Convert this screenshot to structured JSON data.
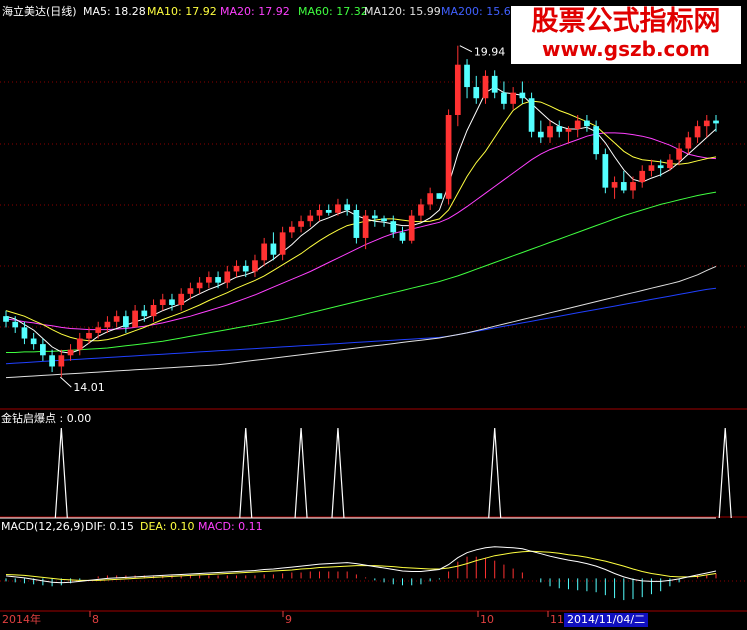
{
  "header": {
    "title": "海立美达(日线)",
    "ma_items": [
      {
        "label": "MA5: 18.28",
        "color": "#ffffff"
      },
      {
        "label": "MA10: 17.92",
        "color": "#ffff40"
      },
      {
        "label": "MA20: 17.92",
        "color": "#ff40ff"
      },
      {
        "label": "MA60: 17.32",
        "color": "#40ff40"
      },
      {
        "label": "MA120: 15.99",
        "color": "#e0e0e0"
      },
      {
        "label": "MA200: 15.60",
        "color": "#4060ff"
      }
    ]
  },
  "watermark": {
    "line1": "股票公式指标网",
    "line2": "www.gszb.com"
  },
  "indicator": {
    "label": "金钻启爆点 : 0.00"
  },
  "macd": {
    "name": "MACD(12,26,9)",
    "dif": "DIF: 0.15",
    "dea": "DEA: 0.10",
    "macd": "MACD: 0.11"
  },
  "x_axis": {
    "labels": [
      "2014年",
      "8",
      "9",
      "10",
      "11"
    ],
    "selected_date": "2014/11/04/二"
  },
  "colors": {
    "up": "#ff3232",
    "down": "#54ffff",
    "grid": "#8b0000",
    "ma5": "#ffffff",
    "ma10": "#ffff40",
    "ma20": "#ff40ff",
    "ma60": "#40ff40",
    "ma120": "#e0e0e0",
    "ma200": "#2040ff"
  },
  "chart_data": {
    "type": "candlestick",
    "annotations": [
      {
        "text": "19.94",
        "kind": "high"
      },
      {
        "text": "14.01",
        "kind": "low"
      }
    ],
    "price_ylim": [
      13.6,
      20.4
    ],
    "candles": [
      [
        15.1,
        15.2,
        14.9,
        15.0
      ],
      [
        15.0,
        15.1,
        14.8,
        14.9
      ],
      [
        14.9,
        15.0,
        14.6,
        14.7
      ],
      [
        14.7,
        14.8,
        14.5,
        14.6
      ],
      [
        14.6,
        14.7,
        14.3,
        14.4
      ],
      [
        14.4,
        14.5,
        14.1,
        14.2
      ],
      [
        14.2,
        14.5,
        14.01,
        14.4
      ],
      [
        14.4,
        14.6,
        14.3,
        14.5
      ],
      [
        14.5,
        14.8,
        14.4,
        14.7
      ],
      [
        14.7,
        14.9,
        14.6,
        14.8
      ],
      [
        14.8,
        15.0,
        14.7,
        14.9
      ],
      [
        14.9,
        15.1,
        14.8,
        15.0
      ],
      [
        15.0,
        15.2,
        14.9,
        15.1
      ],
      [
        15.1,
        15.2,
        14.8,
        14.9
      ],
      [
        14.9,
        15.3,
        14.9,
        15.2
      ],
      [
        15.2,
        15.3,
        15.0,
        15.1
      ],
      [
        15.1,
        15.4,
        15.0,
        15.3
      ],
      [
        15.3,
        15.5,
        15.2,
        15.4
      ],
      [
        15.4,
        15.5,
        15.2,
        15.3
      ],
      [
        15.3,
        15.6,
        15.2,
        15.5
      ],
      [
        15.5,
        15.7,
        15.4,
        15.6
      ],
      [
        15.6,
        15.8,
        15.5,
        15.7
      ],
      [
        15.7,
        15.9,
        15.6,
        15.8
      ],
      [
        15.8,
        15.9,
        15.6,
        15.7
      ],
      [
        15.7,
        16.0,
        15.6,
        15.9
      ],
      [
        15.9,
        16.1,
        15.8,
        16.0
      ],
      [
        16.0,
        16.1,
        15.8,
        15.9
      ],
      [
        15.9,
        16.2,
        15.8,
        16.1
      ],
      [
        16.1,
        16.5,
        16.0,
        16.4
      ],
      [
        16.4,
        16.6,
        16.1,
        16.2
      ],
      [
        16.2,
        16.7,
        16.1,
        16.6
      ],
      [
        16.6,
        16.8,
        16.5,
        16.7
      ],
      [
        16.7,
        16.9,
        16.6,
        16.8
      ],
      [
        16.8,
        17.0,
        16.7,
        16.9
      ],
      [
        16.9,
        17.1,
        16.8,
        17.0
      ],
      [
        17.0,
        17.1,
        16.9,
        16.95
      ],
      [
        16.95,
        17.2,
        16.9,
        17.1
      ],
      [
        17.1,
        17.2,
        16.9,
        17.0
      ],
      [
        17.0,
        17.1,
        16.4,
        16.5
      ],
      [
        16.5,
        17.0,
        16.3,
        16.9
      ],
      [
        16.9,
        17.0,
        16.7,
        16.85
      ],
      [
        16.85,
        16.9,
        16.7,
        16.8
      ],
      [
        16.8,
        16.9,
        16.5,
        16.6
      ],
      [
        16.6,
        16.7,
        16.4,
        16.45
      ],
      [
        16.45,
        17.0,
        16.4,
        16.9
      ],
      [
        16.9,
        17.2,
        16.8,
        17.1
      ],
      [
        17.1,
        17.4,
        17.0,
        17.3
      ],
      [
        17.3,
        17.3,
        17.2,
        17.2
      ],
      [
        17.2,
        18.8,
        17.1,
        18.7
      ],
      [
        18.7,
        19.94,
        18.5,
        19.6
      ],
      [
        19.6,
        19.7,
        19.0,
        19.2
      ],
      [
        19.2,
        19.4,
        18.9,
        19.0
      ],
      [
        19.0,
        19.5,
        18.9,
        19.4
      ],
      [
        19.4,
        19.5,
        19.0,
        19.1
      ],
      [
        19.1,
        19.3,
        18.8,
        18.9
      ],
      [
        18.9,
        19.2,
        18.8,
        19.1
      ],
      [
        19.1,
        19.3,
        18.9,
        19.0
      ],
      [
        19.0,
        19.1,
        18.3,
        18.4
      ],
      [
        18.4,
        18.6,
        18.2,
        18.3
      ],
      [
        18.3,
        18.6,
        18.2,
        18.5
      ],
      [
        18.5,
        18.6,
        18.3,
        18.4
      ],
      [
        18.4,
        18.5,
        18.2,
        18.45
      ],
      [
        18.45,
        18.7,
        18.3,
        18.6
      ],
      [
        18.6,
        18.7,
        18.4,
        18.5
      ],
      [
        18.5,
        18.6,
        17.9,
        18.0
      ],
      [
        18.0,
        18.1,
        17.3,
        17.4
      ],
      [
        17.4,
        17.6,
        17.2,
        17.5
      ],
      [
        17.5,
        17.7,
        17.3,
        17.35
      ],
      [
        17.35,
        17.6,
        17.2,
        17.5
      ],
      [
        17.5,
        17.8,
        17.4,
        17.7
      ],
      [
        17.7,
        17.9,
        17.6,
        17.8
      ],
      [
        17.8,
        17.9,
        17.6,
        17.75
      ],
      [
        17.75,
        18.0,
        17.7,
        17.9
      ],
      [
        17.9,
        18.2,
        17.8,
        18.1
      ],
      [
        18.1,
        18.4,
        18.0,
        18.3
      ],
      [
        18.3,
        18.6,
        18.2,
        18.5
      ],
      [
        18.5,
        18.7,
        18.3,
        18.6
      ],
      [
        18.6,
        18.7,
        18.4,
        18.55
      ]
    ],
    "ma5": [
      15.1,
      15.05,
      14.95,
      14.85,
      14.7,
      14.55,
      14.46,
      14.44,
      14.5,
      14.62,
      14.74,
      14.82,
      14.88,
      14.94,
      15.0,
      15.05,
      15.12,
      15.2,
      15.26,
      15.32,
      15.42,
      15.5,
      15.58,
      15.64,
      15.72,
      15.8,
      15.84,
      15.9,
      16.02,
      16.12,
      16.25,
      16.38,
      16.54,
      16.66,
      16.8,
      16.86,
      16.93,
      16.99,
      16.9,
      16.84,
      16.8,
      16.78,
      16.75,
      16.72,
      16.72,
      16.77,
      16.86,
      17.0,
      17.45,
      18.0,
      18.42,
      18.76,
      19.1,
      19.2,
      19.1,
      19.08,
      19.05,
      18.9,
      18.75,
      18.6,
      18.5,
      18.45,
      18.45,
      18.48,
      18.4,
      18.2,
      17.95,
      17.72,
      17.55,
      17.5,
      17.57,
      17.63,
      17.72,
      17.85,
      18.0,
      18.15,
      18.3,
      18.45
    ],
    "ma10": [
      15.2,
      15.15,
      15.1,
      15.02,
      14.95,
      14.86,
      14.78,
      14.72,
      14.68,
      14.66,
      14.66,
      14.68,
      14.72,
      14.78,
      14.84,
      14.9,
      14.97,
      15.04,
      15.1,
      15.16,
      15.23,
      15.3,
      15.38,
      15.45,
      15.52,
      15.6,
      15.67,
      15.74,
      15.82,
      15.92,
      16.02,
      16.12,
      16.22,
      16.34,
      16.45,
      16.55,
      16.64,
      16.72,
      16.76,
      16.8,
      16.82,
      16.84,
      16.84,
      16.82,
      16.8,
      16.79,
      16.8,
      16.84,
      17.0,
      17.3,
      17.6,
      17.85,
      18.05,
      18.3,
      18.55,
      18.78,
      18.9,
      18.95,
      18.93,
      18.86,
      18.78,
      18.72,
      18.65,
      18.58,
      18.5,
      18.35,
      18.2,
      18.05,
      17.95,
      17.9,
      17.88,
      17.86,
      17.83,
      17.82,
      17.84,
      17.88,
      17.92,
      17.95
    ],
    "ma20": [
      15.05,
      15.03,
      15.0,
      14.98,
      14.95,
      14.93,
      14.9,
      14.88,
      14.87,
      14.86,
      14.86,
      14.86,
      14.87,
      14.88,
      14.9,
      14.92,
      14.95,
      14.98,
      15.02,
      15.06,
      15.1,
      15.15,
      15.2,
      15.25,
      15.3,
      15.36,
      15.42,
      15.48,
      15.55,
      15.62,
      15.69,
      15.76,
      15.83,
      15.9,
      15.98,
      16.06,
      16.14,
      16.22,
      16.3,
      16.38,
      16.45,
      16.52,
      16.58,
      16.62,
      16.66,
      16.7,
      16.74,
      16.78,
      16.85,
      16.95,
      17.06,
      17.18,
      17.3,
      17.42,
      17.54,
      17.66,
      17.78,
      17.9,
      18.0,
      18.08,
      18.14,
      18.2,
      18.26,
      18.32,
      18.36,
      18.38,
      18.38,
      18.37,
      18.35,
      18.32,
      18.28,
      18.22,
      18.16,
      18.08,
      18.0,
      17.96,
      17.93,
      17.92
    ],
    "ma60": [
      14.45,
      14.45,
      14.46,
      14.46,
      14.47,
      14.47,
      14.48,
      14.49,
      14.5,
      14.51,
      14.52,
      14.53,
      14.55,
      14.57,
      14.59,
      14.61,
      14.63,
      14.65,
      14.68,
      14.71,
      14.74,
      14.77,
      14.8,
      14.83,
      14.86,
      14.89,
      14.92,
      14.95,
      14.98,
      15.01,
      15.04,
      15.08,
      15.12,
      15.16,
      15.2,
      15.24,
      15.28,
      15.32,
      15.36,
      15.4,
      15.44,
      15.48,
      15.52,
      15.56,
      15.6,
      15.64,
      15.68,
      15.72,
      15.77,
      15.82,
      15.88,
      15.94,
      16.0,
      16.06,
      16.12,
      16.18,
      16.24,
      16.3,
      16.36,
      16.42,
      16.48,
      16.54,
      16.6,
      16.66,
      16.72,
      16.78,
      16.84,
      16.9,
      16.95,
      17.0,
      17.05,
      17.1,
      17.14,
      17.18,
      17.22,
      17.26,
      17.29,
      17.32
    ],
    "ma120": [
      14.0,
      14.01,
      14.02,
      14.03,
      14.04,
      14.05,
      14.06,
      14.07,
      14.08,
      14.09,
      14.1,
      14.11,
      14.12,
      14.13,
      14.14,
      14.15,
      14.16,
      14.17,
      14.18,
      14.19,
      14.2,
      14.21,
      14.22,
      14.23,
      14.25,
      14.27,
      14.29,
      14.31,
      14.33,
      14.35,
      14.37,
      14.39,
      14.41,
      14.43,
      14.45,
      14.47,
      14.49,
      14.51,
      14.53,
      14.55,
      14.57,
      14.59,
      14.61,
      14.63,
      14.65,
      14.67,
      14.69,
      14.71,
      14.74,
      14.77,
      14.8,
      14.84,
      14.88,
      14.92,
      14.96,
      15.0,
      15.04,
      15.08,
      15.12,
      15.16,
      15.2,
      15.24,
      15.28,
      15.32,
      15.36,
      15.4,
      15.44,
      15.48,
      15.52,
      15.56,
      15.6,
      15.64,
      15.68,
      15.72,
      15.78,
      15.84,
      15.92,
      15.99
    ],
    "ma200": [
      14.25,
      14.26,
      14.27,
      14.28,
      14.29,
      14.3,
      14.31,
      14.32,
      14.33,
      14.34,
      14.35,
      14.36,
      14.37,
      14.38,
      14.39,
      14.4,
      14.41,
      14.42,
      14.43,
      14.44,
      14.45,
      14.46,
      14.47,
      14.48,
      14.49,
      14.5,
      14.51,
      14.52,
      14.53,
      14.54,
      14.55,
      14.56,
      14.57,
      14.58,
      14.59,
      14.6,
      14.61,
      14.62,
      14.63,
      14.64,
      14.65,
      14.66,
      14.67,
      14.68,
      14.69,
      14.7,
      14.71,
      14.72,
      14.74,
      14.77,
      14.8,
      14.83,
      14.86,
      14.89,
      14.92,
      14.95,
      14.98,
      15.01,
      15.04,
      15.07,
      15.1,
      15.13,
      15.16,
      15.19,
      15.22,
      15.25,
      15.28,
      15.31,
      15.34,
      15.37,
      15.4,
      15.43,
      15.46,
      15.49,
      15.52,
      15.55,
      15.58,
      15.6
    ],
    "signal_indices": [
      6,
      26,
      32,
      36,
      53,
      78
    ],
    "signal_ylim": [
      0,
      1
    ],
    "macd_ylim": [
      -0.6,
      0.9
    ],
    "dif": [
      0.05,
      0.03,
      0.01,
      -0.02,
      -0.05,
      -0.08,
      -0.09,
      -0.08,
      -0.06,
      -0.04,
      -0.02,
      0.0,
      0.01,
      0.02,
      0.03,
      0.04,
      0.05,
      0.06,
      0.07,
      0.08,
      0.09,
      0.1,
      0.11,
      0.12,
      0.13,
      0.14,
      0.15,
      0.16,
      0.18,
      0.19,
      0.21,
      0.23,
      0.25,
      0.27,
      0.29,
      0.3,
      0.31,
      0.32,
      0.3,
      0.27,
      0.24,
      0.21,
      0.18,
      0.15,
      0.14,
      0.14,
      0.16,
      0.18,
      0.28,
      0.42,
      0.52,
      0.58,
      0.62,
      0.64,
      0.63,
      0.62,
      0.6,
      0.55,
      0.5,
      0.45,
      0.41,
      0.37,
      0.34,
      0.3,
      0.25,
      0.18,
      0.1,
      0.03,
      -0.02,
      -0.05,
      -0.06,
      -0.06,
      -0.04,
      -0.01,
      0.03,
      0.07,
      0.11,
      0.15
    ],
    "dea": [
      0.08,
      0.07,
      0.06,
      0.04,
      0.02,
      0.0,
      -0.02,
      -0.03,
      -0.04,
      -0.04,
      -0.04,
      -0.03,
      -0.02,
      -0.01,
      0.0,
      0.01,
      0.02,
      0.03,
      0.04,
      0.05,
      0.06,
      0.07,
      0.08,
      0.09,
      0.1,
      0.11,
      0.12,
      0.13,
      0.14,
      0.15,
      0.16,
      0.17,
      0.19,
      0.2,
      0.22,
      0.23,
      0.24,
      0.25,
      0.26,
      0.26,
      0.26,
      0.25,
      0.24,
      0.22,
      0.21,
      0.2,
      0.19,
      0.19,
      0.21,
      0.25,
      0.3,
      0.36,
      0.41,
      0.46,
      0.49,
      0.52,
      0.54,
      0.55,
      0.54,
      0.53,
      0.51,
      0.48,
      0.46,
      0.43,
      0.39,
      0.35,
      0.3,
      0.25,
      0.19,
      0.14,
      0.1,
      0.07,
      0.04,
      0.03,
      0.03,
      0.04,
      0.07,
      0.1
    ]
  }
}
